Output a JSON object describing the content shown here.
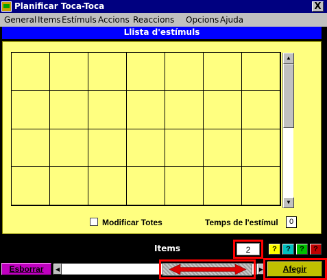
{
  "window": {
    "title": "Planificar Toca-Toca",
    "close_label": "X"
  },
  "menu": [
    "General",
    "Items",
    "Estímuls",
    "Accions",
    "Reaccions",
    "Opcions",
    "Ajuda"
  ],
  "heading": "Llista d'estímuls",
  "grid": {
    "columns": 7,
    "rows": 4
  },
  "options": {
    "modify_all_label": "Modificar Totes",
    "modify_all_checked": false,
    "duration_label": "Temps de l'estímul",
    "duration_value": "0"
  },
  "items_bar": {
    "label": "Items",
    "count": "2",
    "help_buttons": [
      {
        "label": "?",
        "color": "#ffff00"
      },
      {
        "label": "?",
        "color": "#00c0c0"
      },
      {
        "label": "?",
        "color": "#00c000"
      },
      {
        "label": "?",
        "color": "#c00000"
      }
    ]
  },
  "buttons": {
    "delete": "Esborrar",
    "add": "Afegir"
  },
  "colors": {
    "title_bar": "#000080",
    "heading": "#0000ff",
    "panel": "#ffff80",
    "highlight": "#ff0000",
    "arrow": "#e00000"
  }
}
